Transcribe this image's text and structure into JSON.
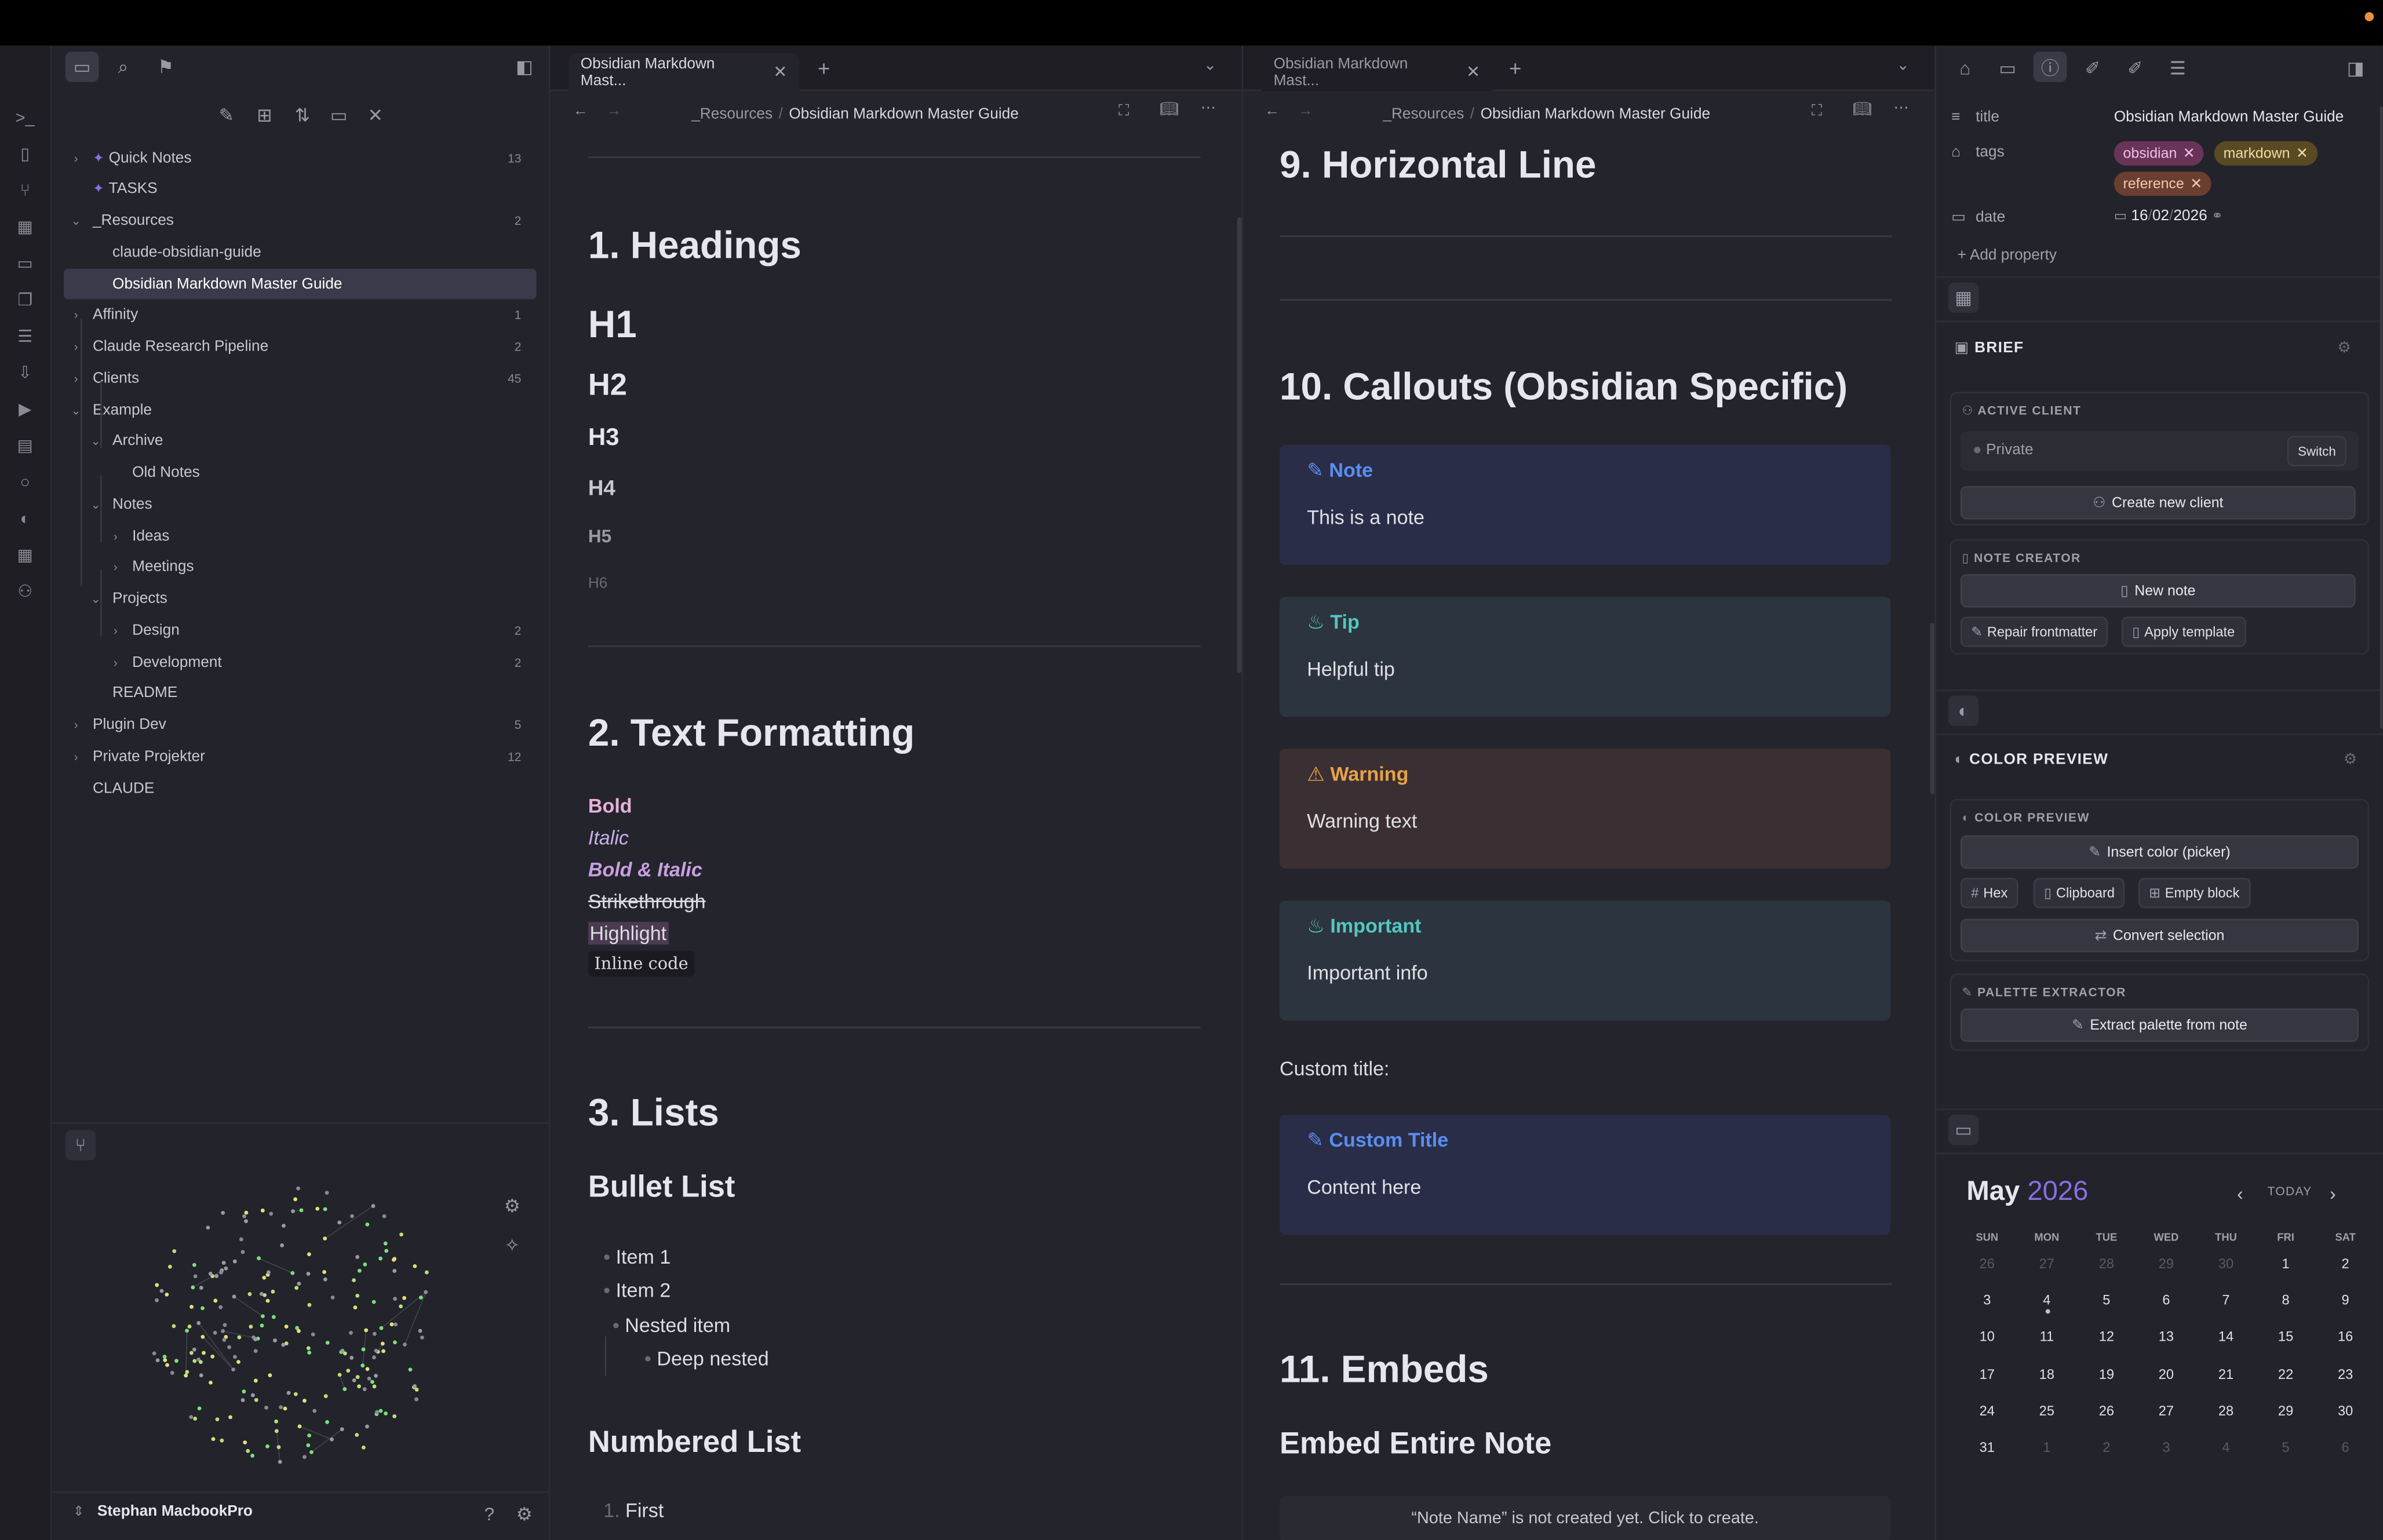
{
  "sidebar": {
    "tree": [
      {
        "label": "Quick Notes",
        "count": "13",
        "chev": "›",
        "star": true,
        "indent": 0
      },
      {
        "label": "TASKS",
        "count": "",
        "chev": "",
        "star": true,
        "indent": 0
      },
      {
        "label": "_Resources",
        "count": "2",
        "chev": "⌄",
        "indent": 0
      },
      {
        "label": "claude-obsidian-guide",
        "count": "",
        "chev": "",
        "indent": 1
      },
      {
        "label": "Obsidian Markdown Master Guide",
        "count": "",
        "chev": "",
        "indent": 1,
        "selected": true
      },
      {
        "label": "Affinity",
        "count": "1",
        "chev": "›",
        "indent": 0
      },
      {
        "label": "Claude Research Pipeline",
        "count": "2",
        "chev": "›",
        "indent": 0
      },
      {
        "label": "Clients",
        "count": "45",
        "chev": "›",
        "indent": 0
      },
      {
        "label": "Example",
        "count": "",
        "chev": "⌄",
        "indent": 0
      },
      {
        "label": "Archive",
        "count": "",
        "chev": "⌄",
        "indent": 1
      },
      {
        "label": "Old Notes",
        "count": "",
        "chev": "",
        "indent": 2
      },
      {
        "label": "Notes",
        "count": "",
        "chev": "⌄",
        "indent": 1
      },
      {
        "label": "Ideas",
        "count": "",
        "chev": "›",
        "indent": 2
      },
      {
        "label": "Meetings",
        "count": "",
        "chev": "›",
        "indent": 2
      },
      {
        "label": "Projects",
        "count": "",
        "chev": "⌄",
        "indent": 1
      },
      {
        "label": "Design",
        "count": "2",
        "chev": "›",
        "indent": 2
      },
      {
        "label": "Development",
        "count": "2",
        "chev": "›",
        "indent": 2
      },
      {
        "label": "README",
        "count": "",
        "chev": "",
        "indent": 1
      },
      {
        "label": "Plugin Dev",
        "count": "5",
        "chev": "›",
        "indent": 0
      },
      {
        "label": "Private Projekter",
        "count": "12",
        "chev": "›",
        "indent": 0
      },
      {
        "label": "CLAUDE",
        "count": "",
        "chev": "",
        "indent": 0
      }
    ],
    "vault_name": "Stephan MacbookPro"
  },
  "left_pane": {
    "tab_title": "Obsidian Markdown Mast...",
    "crumb_folder": "_Resources",
    "crumb_sep": "/",
    "crumb_note": "Obsidian Markdown Master Guide",
    "h_headings": "1. Headings",
    "h1": "H1",
    "h2": "H2",
    "h3": "H3",
    "h4": "H4",
    "h5": "H5",
    "h6": "H6",
    "h_text": "2. Text Formatting",
    "bold": "Bold",
    "italic": "Italic",
    "bold_italic": "Bold & Italic",
    "strike": "Strikethrough",
    "highlight": "Highlight",
    "code": "Inline code",
    "h_lists": "3. Lists",
    "h_bullet": "Bullet List",
    "item1": "Item 1",
    "item2": "Item 2",
    "nested": "Nested item",
    "deep": "Deep nested",
    "h_numbered": "Numbered List",
    "num1": "1.",
    "first": "First"
  },
  "right_pane": {
    "tab_title": "Obsidian Markdown Mast...",
    "crumb_folder": "_Resources",
    "crumb_sep": "/",
    "crumb_note": "Obsidian Markdown Master Guide",
    "h_hr": "9. Horizontal Line",
    "h_callouts": "10. Callouts (Obsidian Specific)",
    "callouts": [
      {
        "title": "Note",
        "body": "This is a note",
        "color": "#5a8ef0",
        "bg": "#2a2d48"
      },
      {
        "title": "Tip",
        "body": "Helpful tip",
        "color": "#53c7c0",
        "bg": "#2c3440"
      },
      {
        "title": "Warning",
        "body": "Warning text",
        "color": "#e8a14a",
        "bg": "#3a2f32"
      },
      {
        "title": "Important",
        "body": "Important info",
        "color": "#53c7c0",
        "bg": "#2c3440"
      }
    ],
    "custom_label": "Custom title:",
    "custom_title": "Custom Title",
    "custom_body": "Content here",
    "h_embeds": "11. Embeds",
    "h_embed_note": "Embed Entire Note",
    "embed_msg": "“Note Name” is not created yet. Click to create."
  },
  "properties": {
    "title_key": "title",
    "title_val": "Obsidian Markdown Master Guide",
    "tags_key": "tags",
    "tags": [
      "obsidian",
      "markdown",
      "reference"
    ],
    "date_key": "date",
    "date_d": "16",
    "date_m": "02",
    "date_y": "2026",
    "add": "Add property"
  },
  "brief": {
    "header": "BRIEF",
    "active_client": "ACTIVE CLIENT",
    "client": "Private",
    "switch": "Switch",
    "create": "Create new client",
    "note_creator": "NOTE CREATOR",
    "new_note": "New note",
    "repair": "Repair frontmatter",
    "apply": "Apply template"
  },
  "color_preview": {
    "header": "COLOR PREVIEW",
    "sub": "COLOR PREVIEW",
    "insert": "Insert color (picker)",
    "hex": "Hex",
    "clipboard": "Clipboard",
    "empty": "Empty block",
    "convert": "Convert selection",
    "palette": "PALETTE EXTRACTOR",
    "extract": "Extract palette from note"
  },
  "calendar": {
    "month": "May",
    "year": "2026",
    "today": "TODAY",
    "days": [
      "SUN",
      "MON",
      "TUE",
      "WED",
      "THU",
      "FRI",
      "SAT"
    ],
    "rows": [
      [
        "26",
        "27",
        "28",
        "29",
        "30",
        "1",
        "2"
      ],
      [
        "3",
        "4",
        "5",
        "6",
        "7",
        "8",
        "9"
      ],
      [
        "10",
        "11",
        "12",
        "13",
        "14",
        "15",
        "16"
      ],
      [
        "17",
        "18",
        "19",
        "20",
        "21",
        "22",
        "23"
      ],
      [
        "24",
        "25",
        "26",
        "27",
        "28",
        "29",
        "30"
      ],
      [
        "31",
        "1",
        "2",
        "3",
        "4",
        "5",
        "6"
      ]
    ]
  },
  "colors": {
    "accent": "#8a6fe0",
    "tag_obsidian": "#8a3f6e",
    "tag_markdown": "#6e5a2a",
    "tag_reference": "#7a4a3a"
  }
}
